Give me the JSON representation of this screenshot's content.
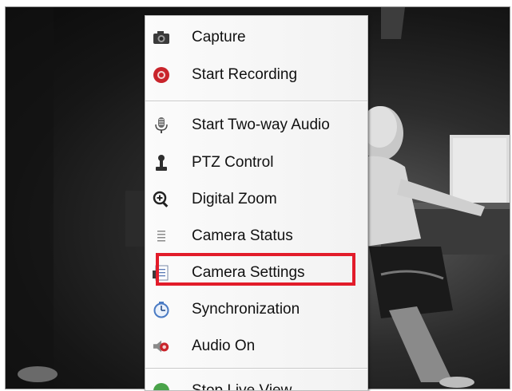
{
  "video": {
    "description_colors": {
      "dark": "#111111",
      "mid": "#4a4a4a",
      "light": "#bfbfbf"
    }
  },
  "context_menu": {
    "items": [
      {
        "label": "Capture",
        "icon": "camera-icon"
      },
      {
        "label": "Start Recording",
        "icon": "record-icon"
      },
      {
        "label": "Start Two-way Audio",
        "icon": "microphone-icon"
      },
      {
        "label": "PTZ Control",
        "icon": "joystick-icon"
      },
      {
        "label": "Digital Zoom",
        "icon": "zoom-in-icon"
      },
      {
        "label": "Camera Status",
        "icon": "list-icon"
      },
      {
        "label": "Camera Settings",
        "icon": "settings-document-icon"
      },
      {
        "label": "Synchronization",
        "icon": "clock-sync-icon"
      },
      {
        "label": "Audio On",
        "icon": "speaker-icon"
      },
      {
        "label": "Stop Live View",
        "icon": "stop-icon"
      }
    ],
    "highlighted_item": "Camera Settings",
    "highlight_color": "#e21c2a"
  }
}
